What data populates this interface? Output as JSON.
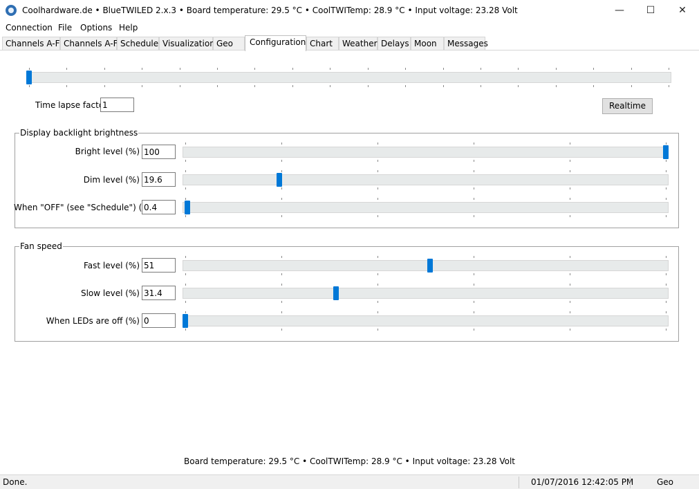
{
  "window": {
    "title": "Coolhardware.de • BlueTWILED 2.x.3 • Board temperature: 29.5 °C • CoolTWITemp: 28.9 °C • Input voltage: 23.28 Volt",
    "icon": "app-globe-icon",
    "controls": {
      "minimize": "—",
      "maximize": "☐",
      "close": "✕"
    }
  },
  "menu": [
    {
      "label": "Connection"
    },
    {
      "label": "File"
    },
    {
      "label": "Options"
    },
    {
      "label": "Help"
    }
  ],
  "tabs": [
    {
      "label": "Channels A-F"
    },
    {
      "label": "Channels A-F"
    },
    {
      "label": "Schedule"
    },
    {
      "label": "Visualization"
    },
    {
      "label": "Geo"
    },
    {
      "label": "Configuration",
      "active": true
    },
    {
      "label": "Chart"
    },
    {
      "label": "Weather"
    },
    {
      "label": "Delays"
    },
    {
      "label": "Moon"
    },
    {
      "label": "Messages"
    }
  ],
  "timelapse": {
    "label": "Time lapse factor",
    "value": "1",
    "slider_fraction": 0.0,
    "realtime_button": "Realtime"
  },
  "backlight": {
    "title": "Display backlight brightness",
    "bright_label": "Bright level (%)",
    "bright_value": "100",
    "bright_fraction": 1.0,
    "dim_label": "Dim level (%)",
    "dim_value": "19.6",
    "dim_fraction": 0.196,
    "off_label": "When \"OFF\" (see \"Schedule\") (%)",
    "off_value": "0.4",
    "off_fraction": 0.004
  },
  "fan": {
    "title": "Fan speed",
    "fast_label": "Fast level (%)",
    "fast_value": "51",
    "fast_fraction": 0.51,
    "slow_label": "Slow level (%)",
    "slow_value": "31.4",
    "slow_fraction": 0.314,
    "ledsoff_label": "When LEDs are off (%)",
    "ledsoff_value": "0",
    "ledsoff_fraction": 0.0
  },
  "footer_info": "Board temperature: 29.5 °C • CoolTWITemp: 28.9 °C • Input voltage: 23.28 Volt",
  "status": {
    "message": "Done.",
    "datetime": "01/07/2016 12:42:05 PM",
    "location": "Geo"
  },
  "colors": {
    "accent": "#0078d7",
    "track": "#e7eaea"
  }
}
